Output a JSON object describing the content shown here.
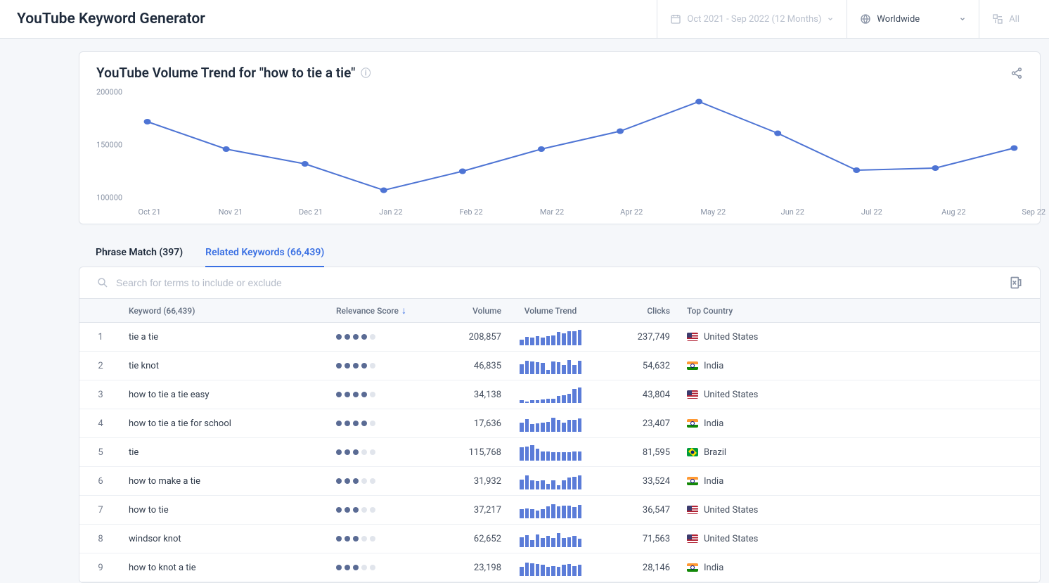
{
  "header": {
    "page_title": "YouTube Keyword Generator",
    "date_range_label": "Oct 2021 - Sep 2022 (12 Months)",
    "region_label": "Worldwide",
    "extra_label": "All"
  },
  "chart_panel": {
    "title": "YouTube Volume Trend for \"how to tie a tie\""
  },
  "chart_data": {
    "type": "line",
    "x": [
      "Oct 21",
      "Nov 21",
      "Dec 21",
      "Jan 22",
      "Feb 22",
      "Mar 22",
      "Apr 22",
      "May 22",
      "Jun 22",
      "Jul 22",
      "Aug 22",
      "Sep 22"
    ],
    "values": [
      172000,
      146000,
      132000,
      107000,
      125000,
      146000,
      163000,
      191000,
      161000,
      126000,
      128000,
      147000
    ],
    "ylim": [
      100000,
      200000
    ],
    "yticks": [
      100000,
      150000,
      200000
    ],
    "title": "YouTube Volume Trend for \"how to tie a tie\"",
    "xlabel": "",
    "ylabel": ""
  },
  "tabs": {
    "phrase_match": {
      "label": "Phrase Match (397)",
      "active": false
    },
    "related": {
      "label": "Related Keywords (66,439)",
      "active": true
    }
  },
  "search": {
    "placeholder": "Search for terms to include or exclude"
  },
  "table": {
    "columns": {
      "keyword": "Keyword (66,439)",
      "relevance": "Relevance Score",
      "volume": "Volume",
      "trend": "Volume Trend",
      "clicks": "Clicks",
      "country": "Top Country"
    },
    "rows": [
      {
        "idx": "1",
        "keyword": "tie a tie",
        "relevance": 4,
        "volume": "208,857",
        "clicks": "237,749",
        "country": "United States",
        "flag": "us",
        "trend": [
          0.35,
          0.5,
          0.45,
          0.55,
          0.45,
          0.55,
          0.6,
          0.8,
          0.7,
          0.85,
          0.85,
          0.9
        ]
      },
      {
        "idx": "2",
        "keyword": "tie knot",
        "relevance": 4,
        "volume": "46,835",
        "clicks": "54,632",
        "country": "India",
        "flag": "in",
        "trend": [
          0.6,
          0.8,
          0.75,
          0.7,
          0.65,
          0.25,
          0.75,
          0.7,
          0.55,
          0.85,
          0.55,
          0.8
        ]
      },
      {
        "idx": "3",
        "keyword": "how to tie a tie easy",
        "relevance": 4,
        "volume": "34,138",
        "clicks": "43,804",
        "country": "United States",
        "flag": "us",
        "trend": [
          0.15,
          0.1,
          0.15,
          0.15,
          0.2,
          0.25,
          0.25,
          0.4,
          0.45,
          0.55,
          0.85,
          0.9
        ]
      },
      {
        "idx": "4",
        "keyword": "how to tie a tie for school",
        "relevance": 4,
        "volume": "17,636",
        "clicks": "23,407",
        "country": "India",
        "flag": "in",
        "trend": [
          0.55,
          0.75,
          0.45,
          0.5,
          0.55,
          0.6,
          0.85,
          0.7,
          0.55,
          0.7,
          0.7,
          0.8
        ]
      },
      {
        "idx": "5",
        "keyword": "tie",
        "relevance": 3,
        "volume": "115,768",
        "clicks": "81,595",
        "country": "Brazil",
        "flag": "br",
        "trend": [
          0.8,
          0.85,
          0.9,
          0.7,
          0.55,
          0.55,
          0.5,
          0.5,
          0.5,
          0.5,
          0.55,
          0.55
        ]
      },
      {
        "idx": "6",
        "keyword": "how to make a tie",
        "relevance": 3,
        "volume": "31,932",
        "clicks": "33,524",
        "country": "India",
        "flag": "in",
        "trend": [
          0.6,
          0.85,
          0.55,
          0.5,
          0.55,
          0.35,
          0.55,
          0.25,
          0.55,
          0.7,
          0.75,
          0.85
        ]
      },
      {
        "idx": "7",
        "keyword": "how to tie",
        "relevance": 3,
        "volume": "37,217",
        "clicks": "36,547",
        "country": "United States",
        "flag": "us",
        "trend": [
          0.55,
          0.6,
          0.55,
          0.45,
          0.55,
          0.7,
          0.85,
          0.7,
          0.75,
          0.75,
          0.65,
          0.8
        ]
      },
      {
        "idx": "8",
        "keyword": "windsor knot",
        "relevance": 3,
        "volume": "62,652",
        "clicks": "71,563",
        "country": "United States",
        "flag": "us",
        "trend": [
          0.6,
          0.7,
          0.4,
          0.75,
          0.55,
          0.65,
          0.55,
          0.85,
          0.55,
          0.6,
          0.65,
          0.5
        ]
      },
      {
        "idx": "9",
        "keyword": "how to knot a tie",
        "relevance": 3,
        "volume": "23,198",
        "clicks": "28,146",
        "country": "India",
        "flag": "in",
        "trend": [
          0.55,
          0.8,
          0.75,
          0.7,
          0.65,
          0.55,
          0.6,
          0.55,
          0.65,
          0.7,
          0.6,
          0.65
        ]
      }
    ]
  }
}
